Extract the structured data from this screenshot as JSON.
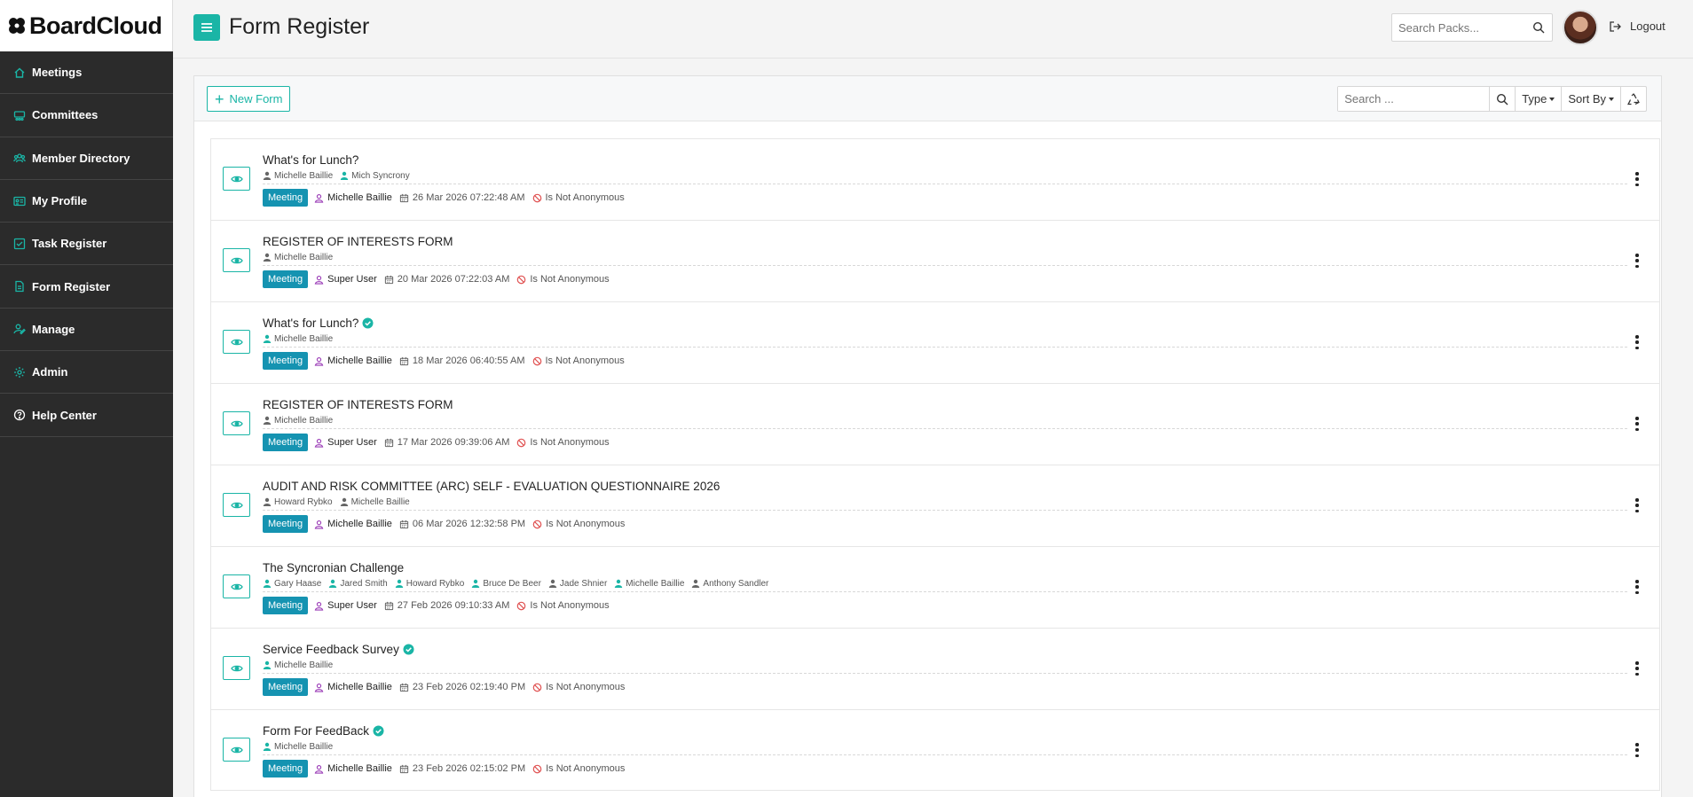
{
  "app": {
    "brand": "BoardCloud",
    "page_title": "Form Register",
    "colors": {
      "accent": "#1ab5a6",
      "badge": "#1593b1",
      "sidebar": "#2b2b2b",
      "creator_icon": "#9b3cb7",
      "not_anon": "#e05252"
    }
  },
  "sidebar": {
    "items": [
      {
        "label": "Meetings",
        "icon": "home-icon"
      },
      {
        "label": "Committees",
        "icon": "committee-icon"
      },
      {
        "label": "Member Directory",
        "icon": "users-icon"
      },
      {
        "label": "My Profile",
        "icon": "id-card-icon"
      },
      {
        "label": "Task Register",
        "icon": "checkbox-icon"
      },
      {
        "label": "Form Register",
        "icon": "document-icon"
      },
      {
        "label": "Manage",
        "icon": "user-edit-icon"
      },
      {
        "label": "Admin",
        "icon": "gear-icon"
      },
      {
        "label": "Help Center",
        "icon": "help-icon"
      }
    ]
  },
  "header": {
    "search_placeholder": "Search Packs...",
    "logout_label": "Logout"
  },
  "toolbar": {
    "new_form_label": "New Form",
    "search_placeholder": "Search ...",
    "type_label": "Type",
    "sort_label": "Sort By"
  },
  "forms": [
    {
      "title": "What's for Lunch?",
      "verified": false,
      "people": [
        {
          "name": "Michelle Baillie",
          "teal": false
        },
        {
          "name": "Mich Syncrony",
          "teal": true
        }
      ],
      "badge": "Meeting",
      "creator": "Michelle Baillie",
      "date": "26 Mar 2026 07:22:48 AM",
      "anon": "Is Not Anonymous"
    },
    {
      "title": "REGISTER OF INTERESTS FORM",
      "verified": false,
      "people": [
        {
          "name": "Michelle Baillie",
          "teal": false
        }
      ],
      "badge": "Meeting",
      "creator": "Super User",
      "date": "20 Mar 2026 07:22:03 AM",
      "anon": "Is Not Anonymous"
    },
    {
      "title": "What's for Lunch?",
      "verified": true,
      "people": [
        {
          "name": "Michelle Baillie",
          "teal": true
        }
      ],
      "badge": "Meeting",
      "creator": "Michelle Baillie",
      "date": "18 Mar 2026 06:40:55 AM",
      "anon": "Is Not Anonymous"
    },
    {
      "title": "REGISTER OF INTERESTS FORM",
      "verified": false,
      "people": [
        {
          "name": "Michelle Baillie",
          "teal": false
        }
      ],
      "badge": "Meeting",
      "creator": "Super User",
      "date": "17 Mar 2026 09:39:06 AM",
      "anon": "Is Not Anonymous"
    },
    {
      "title": "AUDIT AND RISK COMMITTEE (ARC) SELF - EVALUATION QUESTIONNAIRE 2026",
      "verified": false,
      "people": [
        {
          "name": "Howard Rybko",
          "teal": false
        },
        {
          "name": "Michelle Baillie",
          "teal": false
        }
      ],
      "badge": "Meeting",
      "creator": "Michelle Baillie",
      "date": "06 Mar 2026 12:32:58 PM",
      "anon": "Is Not Anonymous"
    },
    {
      "title": "The Syncronian Challenge",
      "verified": false,
      "people": [
        {
          "name": "Gary Haase",
          "teal": true
        },
        {
          "name": "Jared Smith",
          "teal": true
        },
        {
          "name": "Howard Rybko",
          "teal": true
        },
        {
          "name": "Bruce De Beer",
          "teal": true
        },
        {
          "name": "Jade Shnier",
          "teal": false
        },
        {
          "name": "Michelle Baillie",
          "teal": true
        },
        {
          "name": "Anthony Sandler",
          "teal": false
        }
      ],
      "badge": "Meeting",
      "creator": "Super User",
      "date": "27 Feb 2026 09:10:33 AM",
      "anon": "Is Not Anonymous"
    },
    {
      "title": "Service Feedback Survey",
      "verified": true,
      "people": [
        {
          "name": "Michelle Baillie",
          "teal": true
        }
      ],
      "badge": "Meeting",
      "creator": "Michelle Baillie",
      "date": "23 Feb 2026 02:19:40 PM",
      "anon": "Is Not Anonymous"
    },
    {
      "title": "Form For FeedBack",
      "verified": true,
      "people": [
        {
          "name": "Michelle Baillie",
          "teal": true
        }
      ],
      "badge": "Meeting",
      "creator": "Michelle Baillie",
      "date": "23 Feb 2026 02:15:02 PM",
      "anon": "Is Not Anonymous"
    }
  ]
}
